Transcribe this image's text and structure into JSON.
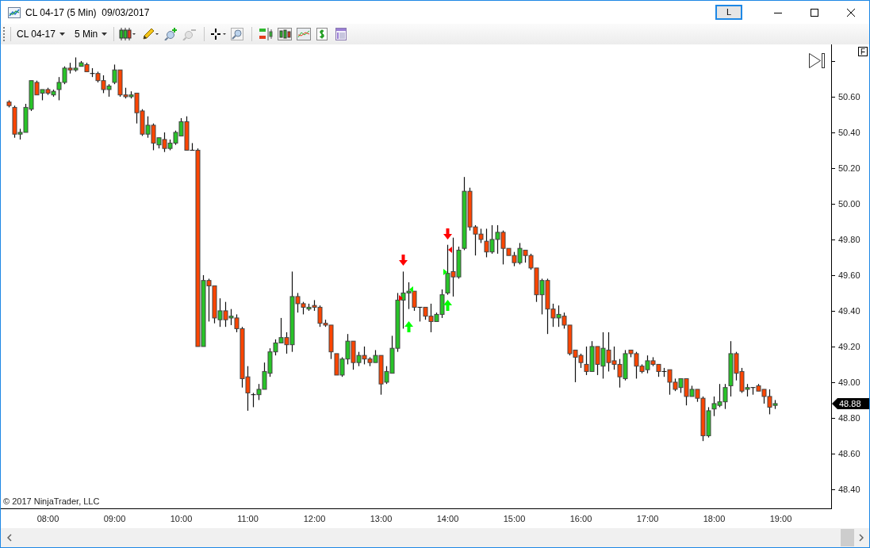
{
  "window": {
    "title": "CL 04-17 (5 Min)  09/03/2017",
    "layout_button": "L"
  },
  "toolbar": {
    "instrument": "CL 04-17",
    "interval": "5 Min"
  },
  "chart": {
    "copyright": "© 2017 NinjaTrader, LLC",
    "scale_button": "F",
    "last_price_label": "48.88",
    "chart_data": {
      "type": "candlestick",
      "ylim": [
        48.293,
        50.893
      ],
      "x": [
        7.4167,
        7.5,
        7.5833,
        7.6667,
        7.75,
        7.8333,
        7.9167,
        8,
        8.0833,
        8.1667,
        8.25,
        8.3333,
        8.4167,
        8.5,
        8.5833,
        8.6667,
        8.75,
        8.8333,
        8.9167,
        9,
        9.0833,
        9.1667,
        9.25,
        9.3333,
        9.4167,
        9.5,
        9.5833,
        9.6667,
        9.75,
        9.8333,
        9.9167,
        10,
        10.0833,
        10.1667,
        10.25,
        10.3333,
        10.4167,
        10.5,
        10.5833,
        10.6667,
        10.75,
        10.8333,
        10.9167,
        11,
        11.0833,
        11.1667,
        11.25,
        11.3333,
        11.4167,
        11.5,
        11.5833,
        11.6667,
        11.75,
        11.8333,
        11.9167,
        12,
        12.0833,
        12.1667,
        12.25,
        12.3333,
        12.4167,
        12.5,
        12.5833,
        12.6667,
        12.75,
        12.8333,
        12.9167,
        13,
        13.0833,
        13.1667,
        13.25,
        13.3333,
        13.4167,
        13.5,
        13.5833,
        13.6667,
        13.75,
        13.8333,
        13.9167,
        14,
        14.0833,
        14.1667,
        14.25,
        14.3333,
        14.4167,
        14.5,
        14.5833,
        14.6667,
        14.75,
        14.8333,
        14.9167,
        15,
        15.0833,
        15.1667,
        15.25,
        15.3333,
        15.4167,
        15.5,
        15.5833,
        15.6667,
        15.75,
        15.8333,
        15.9167,
        16,
        16.0833,
        16.1667,
        16.25,
        16.3333,
        16.4167,
        16.5,
        16.5833,
        16.6667,
        16.75,
        16.8333,
        16.9167,
        17,
        17.0833,
        17.1667,
        17.25,
        17.3333,
        17.4167,
        17.5,
        17.5833,
        17.6667,
        17.75,
        17.8333,
        17.9167,
        18,
        18.0833,
        18.1667,
        18.25,
        18.3333,
        18.4167,
        18.5,
        18.5833,
        18.6667,
        18.75,
        18.8333,
        18.9167
      ],
      "xlim": [
        7.2976,
        19.7619
      ],
      "xticks": [
        {
          "value": 8,
          "label": "08:00"
        },
        {
          "value": 9,
          "label": "09:00"
        },
        {
          "value": 10,
          "label": "10:00"
        },
        {
          "value": 11,
          "label": "11:00"
        },
        {
          "value": 12,
          "label": "12:00"
        },
        {
          "value": 13,
          "label": "13:00"
        },
        {
          "value": 14,
          "label": "14:00"
        },
        {
          "value": 15,
          "label": "15:00"
        },
        {
          "value": 16,
          "label": "16:00"
        },
        {
          "value": 17,
          "label": "17:00"
        },
        {
          "value": 18,
          "label": "18:00"
        },
        {
          "value": 19,
          "label": "19:00"
        }
      ],
      "yticks": [
        {
          "value": 48.4,
          "label": "48.40"
        },
        {
          "value": 48.6,
          "label": "48.60"
        },
        {
          "value": 48.8,
          "label": "48.80"
        },
        {
          "value": 49.0,
          "label": "49.00"
        },
        {
          "value": 49.2,
          "label": "49.20"
        },
        {
          "value": 49.4,
          "label": "49.40"
        },
        {
          "value": 49.6,
          "label": "49.60"
        },
        {
          "value": 49.8,
          "label": "49.80"
        },
        {
          "value": 50.0,
          "label": "50.00"
        },
        {
          "value": 50.2,
          "label": "50.20"
        },
        {
          "value": 50.4,
          "label": "50.40"
        },
        {
          "value": 50.6,
          "label": "50.60"
        }
      ],
      "ohlc": [
        [
          50.57,
          50.58,
          50.54,
          50.55
        ],
        [
          50.54,
          50.55,
          50.37,
          50.39
        ],
        [
          50.39,
          50.42,
          50.36,
          50.4
        ],
        [
          50.4,
          50.56,
          50.4,
          50.54
        ],
        [
          50.53,
          50.69,
          50.52,
          50.69
        ],
        [
          50.68,
          50.69,
          50.61,
          50.61
        ],
        [
          50.62,
          50.64,
          50.58,
          50.64
        ],
        [
          50.64,
          50.65,
          50.61,
          50.62
        ],
        [
          50.61,
          50.64,
          50.6,
          50.63
        ],
        [
          50.64,
          50.71,
          50.58,
          50.68
        ],
        [
          50.68,
          50.77,
          50.67,
          50.76
        ],
        [
          50.76,
          50.79,
          50.73,
          50.75
        ],
        [
          50.75,
          50.82,
          50.74,
          50.76
        ],
        [
          50.77,
          50.8,
          50.77,
          50.79
        ],
        [
          50.78,
          50.79,
          50.74,
          50.74
        ],
        [
          50.73,
          50.76,
          50.71,
          50.73
        ],
        [
          50.73,
          50.74,
          50.68,
          50.69
        ],
        [
          50.69,
          50.72,
          50.62,
          50.64
        ],
        [
          50.64,
          50.67,
          50.6,
          50.66
        ],
        [
          50.68,
          50.78,
          50.67,
          50.75
        ],
        [
          50.75,
          50.75,
          50.6,
          50.61
        ],
        [
          50.61,
          50.65,
          50.59,
          50.6
        ],
        [
          50.6,
          50.63,
          50.59,
          50.61
        ],
        [
          50.62,
          50.62,
          50.45,
          50.51
        ],
        [
          50.52,
          50.53,
          50.38,
          50.39
        ],
        [
          50.39,
          50.49,
          50.37,
          50.44
        ],
        [
          50.44,
          50.45,
          50.3,
          50.34
        ],
        [
          50.33,
          50.37,
          50.31,
          50.37
        ],
        [
          50.36,
          50.4,
          50.29,
          50.31
        ],
        [
          50.31,
          50.36,
          50.3,
          50.34
        ],
        [
          50.34,
          50.41,
          50.33,
          50.4
        ],
        [
          50.38,
          50.48,
          50.38,
          50.46
        ],
        [
          50.46,
          50.49,
          50.3,
          50.3
        ],
        [
          50.3,
          50.34,
          50.3,
          50.3
        ],
        [
          50.3,
          50.31,
          49.2,
          49.2
        ],
        [
          49.2,
          49.6,
          49.2,
          49.57
        ],
        [
          49.57,
          49.58,
          49.34,
          49.54
        ],
        [
          49.54,
          49.54,
          49.33,
          49.36
        ],
        [
          49.35,
          49.47,
          49.31,
          49.4
        ],
        [
          49.4,
          49.45,
          49.31,
          49.35
        ],
        [
          49.36,
          49.41,
          49.32,
          49.37
        ],
        [
          49.36,
          49.38,
          49.28,
          49.3
        ],
        [
          49.3,
          49.31,
          48.97,
          49.02
        ],
        [
          49.03,
          49.09,
          48.84,
          48.94
        ],
        [
          48.93,
          48.94,
          48.86,
          48.93
        ],
        [
          48.93,
          48.99,
          48.9,
          48.96
        ],
        [
          48.96,
          49.11,
          48.96,
          49.06
        ],
        [
          49.05,
          49.19,
          49.03,
          49.17
        ],
        [
          49.17,
          49.24,
          49.15,
          49.22
        ],
        [
          49.22,
          49.36,
          49.22,
          49.25
        ],
        [
          49.25,
          49.28,
          49.16,
          49.21
        ],
        [
          49.21,
          49.62,
          49.17,
          49.48
        ],
        [
          49.48,
          49.5,
          49.39,
          49.44
        ],
        [
          49.44,
          49.45,
          49.38,
          49.42
        ],
        [
          49.41,
          49.44,
          49.4,
          49.42
        ],
        [
          49.43,
          49.46,
          49.4,
          49.42
        ],
        [
          49.42,
          49.43,
          49.31,
          49.33
        ],
        [
          49.33,
          49.35,
          49.31,
          49.32
        ],
        [
          49.32,
          49.32,
          49.13,
          49.17
        ],
        [
          49.16,
          49.16,
          49.04,
          49.04
        ],
        [
          49.04,
          49.14,
          49.03,
          49.13
        ],
        [
          49.13,
          49.27,
          49.1,
          49.23
        ],
        [
          49.23,
          49.23,
          49.07,
          49.11
        ],
        [
          49.11,
          49.17,
          49.09,
          49.15
        ],
        [
          49.15,
          49.2,
          49.1,
          49.13
        ],
        [
          49.13,
          49.14,
          49.09,
          49.11
        ],
        [
          49.11,
          49.18,
          49.11,
          49.15
        ],
        [
          49.15,
          49.15,
          48.93,
          48.99
        ],
        [
          49.0,
          49.09,
          48.99,
          49.06
        ],
        [
          49.05,
          49.26,
          49.05,
          49.19
        ],
        [
          49.19,
          49.5,
          49.17,
          49.46
        ],
        [
          49.46,
          49.62,
          49.3,
          49.5
        ],
        [
          49.5,
          49.56,
          49.41,
          49.51
        ],
        [
          49.51,
          49.51,
          49.4,
          49.42
        ],
        [
          49.42,
          49.42,
          49.34,
          49.42
        ],
        [
          49.42,
          49.42,
          49.35,
          49.37
        ],
        [
          49.37,
          49.44,
          49.28,
          49.34
        ],
        [
          49.34,
          49.39,
          49.34,
          49.38
        ],
        [
          49.38,
          49.52,
          49.36,
          49.49
        ],
        [
          49.5,
          49.77,
          49.49,
          49.61
        ],
        [
          49.62,
          49.81,
          49.48,
          49.59
        ],
        [
          49.59,
          49.76,
          49.58,
          49.74
        ],
        [
          49.75,
          50.15,
          49.74,
          50.07
        ],
        [
          50.07,
          50.09,
          49.85,
          49.87
        ],
        [
          49.87,
          49.88,
          49.71,
          49.83
        ],
        [
          49.83,
          49.86,
          49.78,
          49.8
        ],
        [
          49.79,
          49.86,
          49.7,
          49.73
        ],
        [
          49.73,
          49.88,
          49.72,
          49.8
        ],
        [
          49.8,
          49.88,
          49.72,
          49.84
        ],
        [
          49.84,
          49.85,
          49.66,
          49.75
        ],
        [
          49.75,
          49.75,
          49.71,
          49.71
        ],
        [
          49.71,
          49.73,
          49.65,
          49.67
        ],
        [
          49.67,
          49.78,
          49.66,
          49.75
        ],
        [
          49.74,
          49.74,
          49.67,
          49.71
        ],
        [
          49.71,
          49.72,
          49.63,
          49.64
        ],
        [
          49.64,
          49.64,
          49.45,
          49.49
        ],
        [
          49.49,
          49.58,
          49.38,
          49.57
        ],
        [
          49.57,
          49.58,
          49.27,
          49.41
        ],
        [
          49.41,
          49.44,
          49.31,
          49.36
        ],
        [
          49.36,
          49.43,
          49.31,
          49.38
        ],
        [
          49.37,
          49.39,
          49.3,
          49.32
        ],
        [
          49.32,
          49.32,
          49.15,
          49.16
        ],
        [
          49.18,
          49.18,
          49.0,
          49.14
        ],
        [
          49.15,
          49.16,
          49.08,
          49.11
        ],
        [
          49.1,
          49.2,
          49.04,
          49.06
        ],
        [
          49.06,
          49.23,
          49.06,
          49.2
        ],
        [
          49.2,
          49.2,
          49.04,
          49.1
        ],
        [
          49.09,
          49.28,
          49.02,
          49.19
        ],
        [
          49.18,
          49.28,
          49.06,
          49.11
        ],
        [
          49.12,
          49.2,
          49.07,
          49.1
        ],
        [
          49.1,
          49.13,
          48.97,
          49.03
        ],
        [
          49.02,
          49.18,
          49.01,
          49.16
        ],
        [
          49.18,
          49.18,
          49.14,
          49.16
        ],
        [
          49.16,
          49.17,
          49.02,
          49.09
        ],
        [
          49.09,
          49.1,
          49.05,
          49.06
        ],
        [
          49.07,
          49.15,
          49.05,
          49.12
        ],
        [
          49.12,
          49.14,
          49.09,
          49.1
        ],
        [
          49.1,
          49.1,
          49.03,
          49.06
        ],
        [
          49.06,
          49.08,
          49.03,
          49.06
        ],
        [
          49.07,
          49.07,
          48.93,
          49.0
        ],
        [
          49.0,
          49.02,
          48.95,
          48.96
        ],
        [
          48.97,
          49.02,
          48.94,
          49.02
        ],
        [
          49.02,
          49.02,
          48.87,
          48.92
        ],
        [
          48.92,
          48.98,
          48.92,
          48.96
        ],
        [
          48.96,
          48.96,
          48.89,
          48.91
        ],
        [
          48.91,
          48.92,
          48.67,
          48.7
        ],
        [
          48.7,
          48.86,
          48.69,
          48.84
        ],
        [
          48.85,
          48.92,
          48.81,
          48.88
        ],
        [
          48.87,
          48.99,
          48.86,
          48.89
        ],
        [
          48.89,
          48.99,
          48.85,
          48.97
        ],
        [
          48.98,
          49.23,
          48.92,
          49.16
        ],
        [
          49.16,
          49.17,
          49.01,
          49.05
        ],
        [
          49.06,
          49.08,
          48.94,
          48.95
        ],
        [
          48.96,
          48.99,
          48.92,
          48.97
        ],
        [
          48.97,
          48.97,
          48.93,
          48.97
        ],
        [
          48.98,
          48.99,
          48.95,
          48.95
        ],
        [
          48.96,
          48.96,
          48.88,
          48.92
        ],
        [
          48.92,
          48.96,
          48.82,
          48.86
        ],
        [
          48.87,
          48.9,
          48.85,
          48.88
        ]
      ]
    },
    "signals": [
      {
        "kind": "sell-arrow"
      },
      {
        "kind": "sell-triangle-right"
      },
      {
        "kind": "buy-triangle-left"
      },
      {
        "kind": "buy-arrow"
      },
      {
        "kind": "sell-arrow"
      },
      {
        "kind": "buy-triangle-right"
      },
      {
        "kind": "sell-triangle-left"
      },
      {
        "kind": "buy-arrow"
      }
    ]
  }
}
